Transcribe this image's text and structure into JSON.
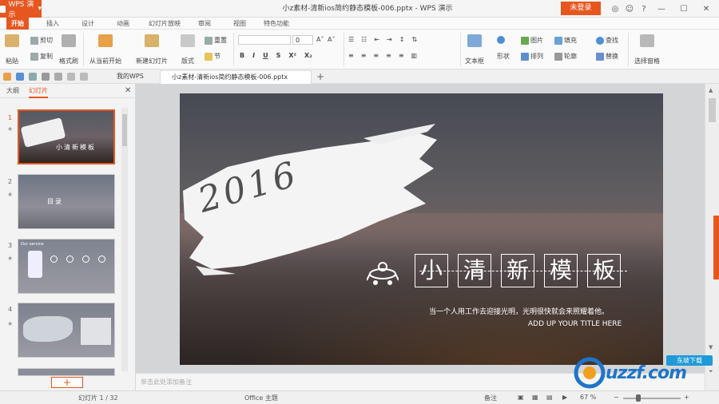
{
  "app": {
    "button_label": "WPS 演示",
    "title": "小z素材-清新ios简约静态模板-006.pptx - WPS 演示",
    "login_label": "未登录"
  },
  "menu": {
    "items": [
      "开始",
      "插入",
      "设计",
      "动画",
      "幻灯片放映",
      "审阅",
      "视图",
      "特色功能"
    ]
  },
  "ribbon": {
    "paste": "粘贴",
    "cut": "剪切",
    "copy": "复制",
    "format_painter": "格式刷",
    "from_current": "从当前开始",
    "new_slide": "新建幻灯片",
    "layout": "版式",
    "reset": "重置",
    "section": "节",
    "font_size": "0",
    "text_box": "文本框",
    "shape": "形状",
    "arrange": "排列",
    "outline": "轮廓",
    "picture": "图片",
    "fill": "填充",
    "find": "查找",
    "replace": "替换",
    "select_pane": "选择窗格"
  },
  "tabs": {
    "wps": "我的WPS",
    "doc": "小z素材-清新ios简约静态模板-006.pptx"
  },
  "panel": {
    "tab_outline": "大纲",
    "tab_slides": "幻灯片",
    "nums": [
      "1",
      "2",
      "3",
      "4"
    ]
  },
  "slide": {
    "year": "2016",
    "chars": [
      "小",
      "清",
      "新",
      "模",
      "板"
    ],
    "subtitle": "当一个人用工作去迎接光明，光明很快就会来照耀着他。",
    "subtitle_en": "ADD UP YOUR TITLE HERE"
  },
  "thumbs": {
    "t1": "小清新模板",
    "t2": "目录",
    "t3": "Our service"
  },
  "notes": {
    "placeholder": "单击此处添加备注"
  },
  "status": {
    "slide_info": "幻灯片 1 / 32",
    "theme": "Office 主题",
    "notes_toggle": "备注",
    "zoom": "67 %"
  },
  "watermark": {
    "text": "uzzf.com",
    "badge": "东坡下载"
  }
}
